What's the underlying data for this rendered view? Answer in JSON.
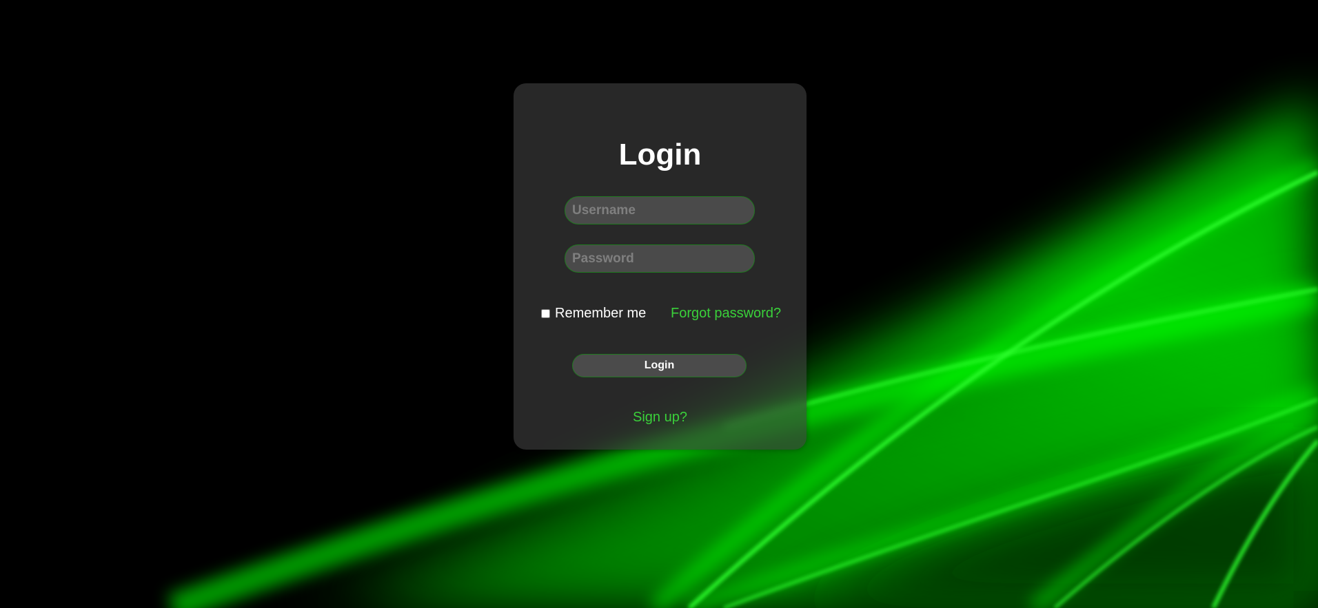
{
  "login_form": {
    "title": "Login",
    "username_placeholder": "Username",
    "password_placeholder": "Password",
    "remember_label": "Remember me",
    "remember_checked": false,
    "forgot_label": "Forgot password?",
    "submit_label": "Login",
    "signup_label": "Sign up?"
  },
  "colors": {
    "background": "#000000",
    "accent_green": "#3ad13a",
    "neon_green": "#00ff00",
    "card": "#3a3a3a",
    "input": "#4a4a4a",
    "border_green": "#1f7a1f"
  }
}
